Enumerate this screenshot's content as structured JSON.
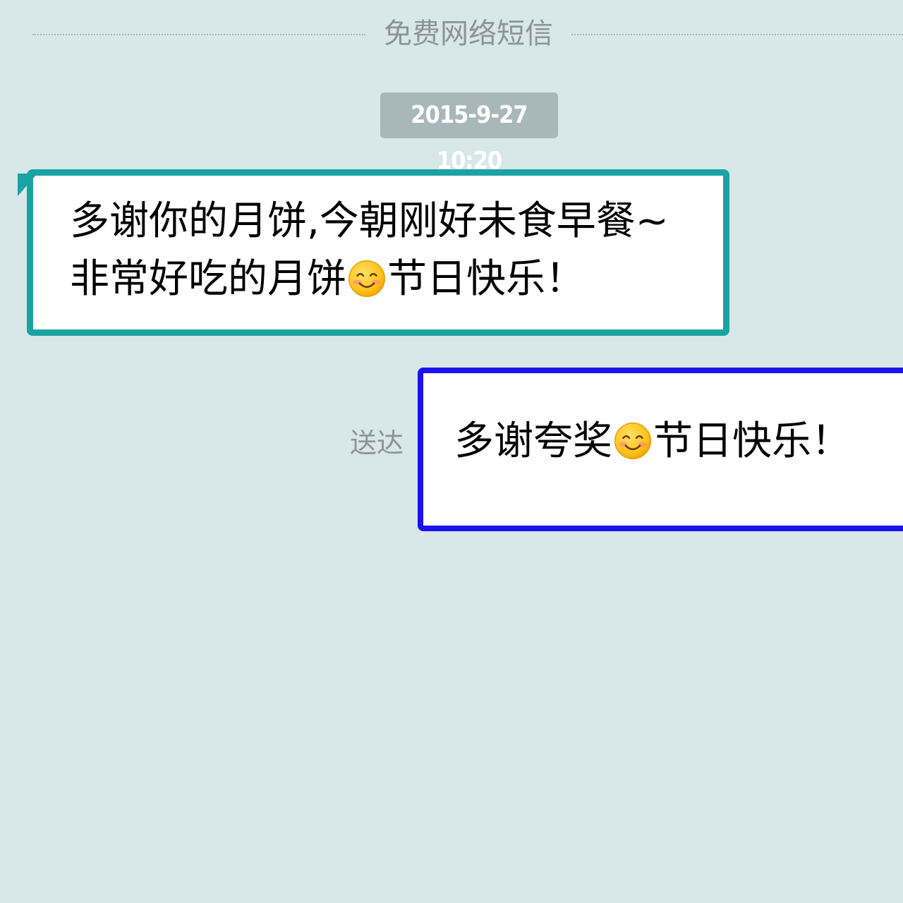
{
  "header": {
    "title": "免费网络短信"
  },
  "timestamp": "2015-9-27 10:20",
  "messages": [
    {
      "direction": "incoming",
      "line1": "多谢你的月饼,今朝刚好未食早餐~",
      "line2_before_emoji": "非常好吃的月饼",
      "emoji": "smiling-face-icon",
      "line2_after_emoji": "节日快乐！"
    },
    {
      "direction": "outgoing",
      "status": "送达",
      "text_before_emoji": "多谢夸奖",
      "emoji": "smiling-face-icon",
      "text_after_emoji": "节日快乐！"
    }
  ],
  "colors": {
    "background": "#d8e7e7",
    "incoming_border": "#1aa3a3",
    "outgoing_border": "#1a13f0",
    "timestamp_bg": "#a8b7b7",
    "muted_text": "#8a9696"
  }
}
